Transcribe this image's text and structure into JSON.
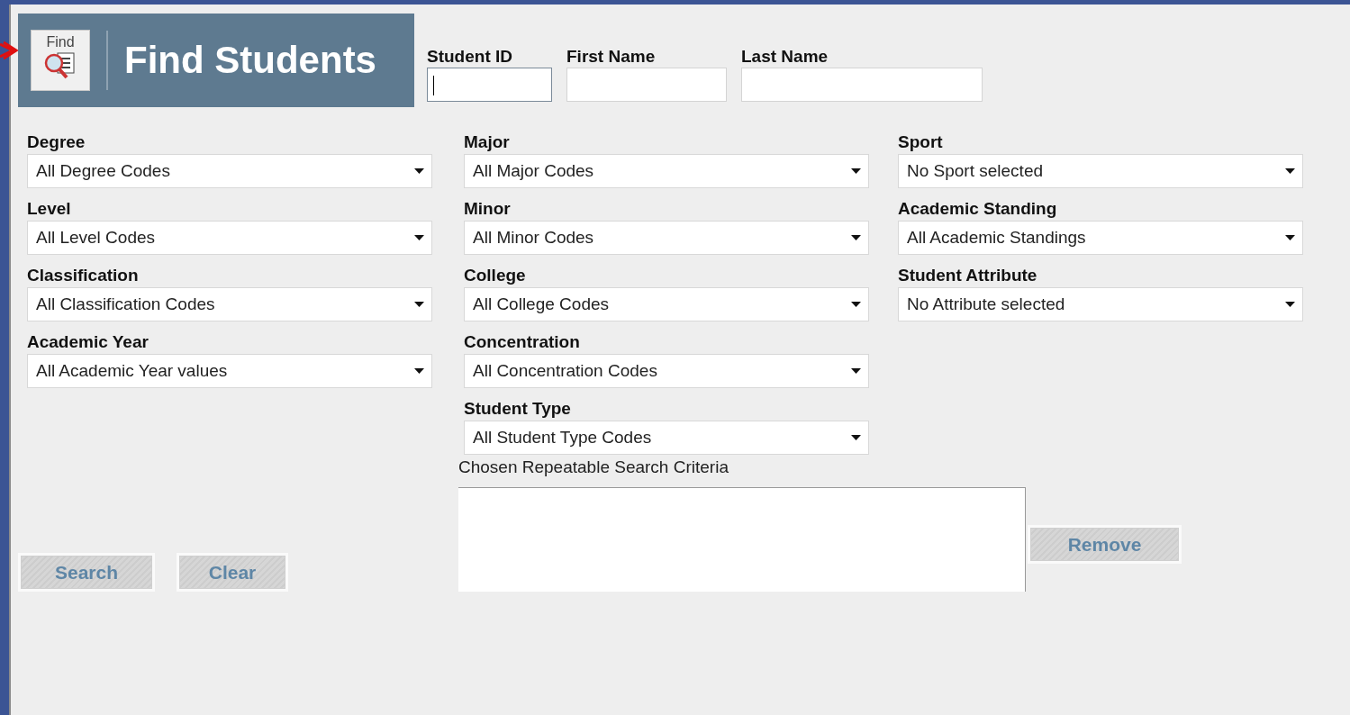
{
  "header": {
    "icon_label": "Find",
    "title": "Find Students"
  },
  "id_fields": [
    {
      "label": "Student ID",
      "focused": true
    },
    {
      "label": "First Name",
      "focused": false
    },
    {
      "label": "Last Name",
      "focused": false
    }
  ],
  "filter_columns": [
    [
      {
        "label": "Degree",
        "value": "All Degree Codes"
      },
      {
        "label": "Level",
        "value": "All Level Codes"
      },
      {
        "label": "Classification",
        "value": "All Classification Codes"
      },
      {
        "label": "Academic Year",
        "value": "All Academic Year values"
      }
    ],
    [
      {
        "label": "Major",
        "value": "All Major Codes"
      },
      {
        "label": "Minor",
        "value": "All Minor Codes"
      },
      {
        "label": "College",
        "value": "All College Codes"
      },
      {
        "label": "Concentration",
        "value": "All Concentration Codes"
      },
      {
        "label": "Student Type",
        "value": "All Student Type Codes"
      }
    ],
    [
      {
        "label": "Sport",
        "value": "No Sport selected"
      },
      {
        "label": "Academic Standing",
        "value": "All Academic Standings"
      },
      {
        "label": "Student Attribute",
        "value": "No Attribute selected"
      }
    ]
  ],
  "criteria": {
    "label": "Chosen Repeatable Search Criteria"
  },
  "buttons": [
    {
      "label": "Search"
    },
    {
      "label": "Clear"
    }
  ],
  "remove_button": {
    "label": "Remove"
  }
}
